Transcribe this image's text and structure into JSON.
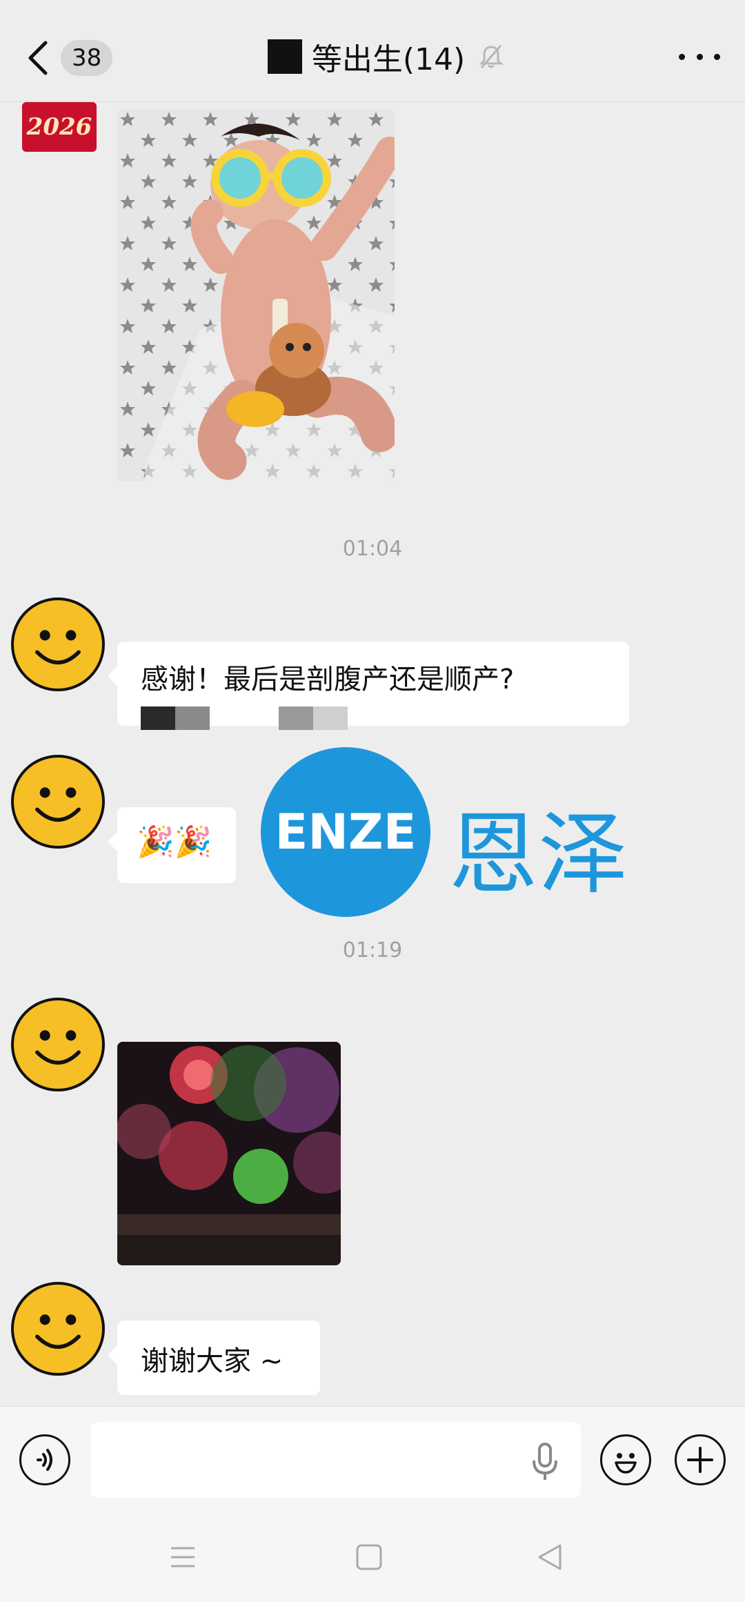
{
  "header": {
    "unread_count": "38",
    "title": "等出生(14)",
    "back_icon": "chevron-left-icon",
    "mute_icon": "bell-off-icon",
    "more_icon": "more-dots-icon"
  },
  "messages": {
    "avatar_label_2026": "2026",
    "timestamp_1": "01:04",
    "text_1": "感谢！最后是剖腹产还是顺产?",
    "emoji_2": "🎉🎉",
    "timestamp_2": "01:19",
    "text_4": "谢谢大家 ~"
  },
  "watermark": {
    "logo_text": "ENZE",
    "cn_text": "恩泽",
    "color": "#1e96dc"
  },
  "input_bar": {
    "placeholder": "",
    "voice_icon": "voice-icon",
    "mic_icon": "mic-icon",
    "emoji_icon": "emoji-icon",
    "plus_icon": "plus-icon"
  },
  "navbar": {
    "menu_icon": "menu-icon",
    "home_icon": "home-icon",
    "back_icon": "back-triangle-icon"
  }
}
